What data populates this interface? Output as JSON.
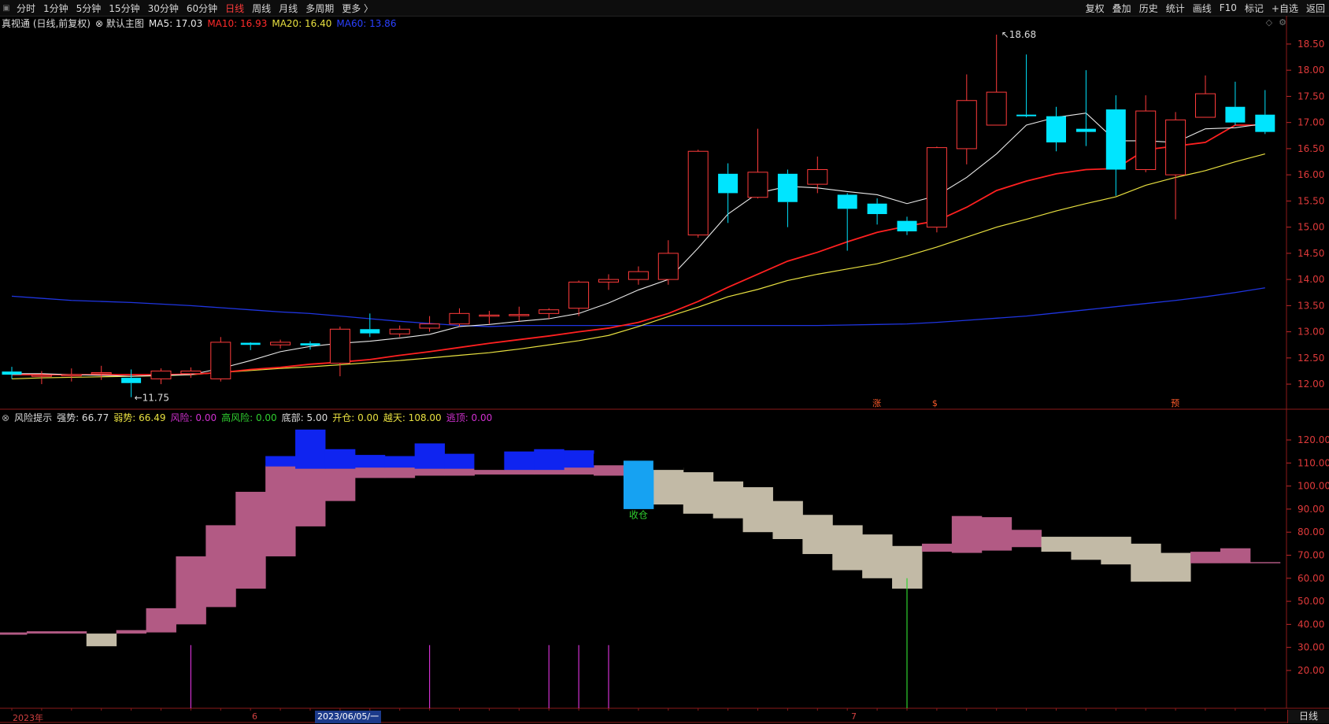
{
  "toolbar": {
    "left": [
      "分时",
      "1分钟",
      "5分钟",
      "15分钟",
      "30分钟",
      "60分钟",
      "日线",
      "周线",
      "月线",
      "多周期",
      "更多 〉"
    ],
    "active": "日线",
    "right": [
      "复权",
      "叠加",
      "历史",
      "统计",
      "画线",
      "F10",
      "标记",
      "+自选",
      "返回"
    ]
  },
  "main_legend": {
    "title": "真视通 (日线,前复权)",
    "template": "默认主图",
    "ma5_label": "MA5: 17.03",
    "ma10_label": "MA10: 16.93",
    "ma20_label": "MA20: 16.40",
    "ma60_label": "MA60: 13.86"
  },
  "sub_legend": {
    "title": "风险提示",
    "strong": "强势: 66.77",
    "weak": "弱势: 66.49",
    "risk": "风险: 0.00",
    "high_risk": "高风险: 0.00",
    "bottom": "底部: 5.00",
    "open": "开仓: 0.00",
    "sky": "越天: 108.00",
    "top_escape": "逃顶: 0.00"
  },
  "annotations": {
    "high": "18.68",
    "low": "11.75",
    "close_signal": "收仓",
    "markers": [
      "涨",
      "$",
      "预"
    ]
  },
  "bottom_axis": {
    "labels": [
      "2023年",
      "6",
      "7"
    ],
    "current_date": "2023/06/05/一",
    "period": "日线"
  },
  "colors": {
    "up": "#ff3b3b",
    "down": "#00e5ff",
    "ma5": "#e8e8e8",
    "ma10": "#ff2020",
    "ma20": "#e8e040",
    "ma60": "#1f35e0",
    "pink": "#b25a84",
    "beige": "#c2baa6",
    "blue": "#0f24f0",
    "light_blue": "#16a2f2"
  },
  "chart_data": {
    "type": "candlestick",
    "y_ticks_main": [
      "12.00",
      "12.50",
      "13.00",
      "13.50",
      "14.00",
      "14.50",
      "15.00",
      "15.50",
      "16.00",
      "16.50",
      "17.00",
      "17.50",
      "18.00",
      "18.50"
    ],
    "y_ticks_sub": [
      "20.00",
      "30.00",
      "40.00",
      "50.00",
      "60.00",
      "70.00",
      "80.00",
      "90.00",
      "100.00",
      "110.00",
      "120.00"
    ],
    "ylim_main": [
      11.52,
      18.77
    ],
    "ylim_sub": [
      3.6,
      126.5
    ],
    "candles": [
      [
        12.24,
        12.18,
        12.33,
        12.1
      ],
      [
        12.15,
        12.17,
        12.25,
        12.0
      ],
      [
        12.16,
        12.18,
        12.3,
        12.05
      ],
      [
        12.2,
        12.22,
        12.35,
        12.08
      ],
      [
        12.12,
        12.02,
        12.28,
        11.75
      ],
      [
        12.1,
        12.25,
        12.3,
        12.0
      ],
      [
        12.2,
        12.25,
        12.32,
        12.12
      ],
      [
        12.1,
        12.8,
        12.9,
        12.05
      ],
      [
        12.79,
        12.75,
        12.8,
        12.65
      ],
      [
        12.75,
        12.8,
        12.85,
        12.68
      ],
      [
        12.78,
        12.74,
        12.82,
        12.66
      ],
      [
        12.4,
        13.05,
        13.1,
        12.15
      ],
      [
        13.05,
        12.97,
        13.35,
        12.9
      ],
      [
        12.96,
        13.05,
        13.12,
        12.9
      ],
      [
        13.07,
        13.15,
        13.3,
        13.0
      ],
      [
        13.15,
        13.35,
        13.45,
        13.1
      ],
      [
        13.3,
        13.32,
        13.4,
        13.15
      ],
      [
        13.31,
        13.33,
        13.48,
        13.2
      ],
      [
        13.35,
        13.42,
        13.45,
        13.25
      ],
      [
        13.45,
        13.95,
        13.98,
        13.3
      ],
      [
        13.95,
        14.0,
        14.1,
        13.8
      ],
      [
        14.0,
        14.15,
        14.25,
        13.9
      ],
      [
        14.0,
        14.5,
        14.75,
        13.9
      ],
      [
        14.85,
        16.45,
        16.48,
        14.8
      ],
      [
        16.02,
        15.65,
        16.22,
        15.08
      ],
      [
        15.57,
        16.05,
        16.88,
        15.55
      ],
      [
        16.02,
        15.48,
        16.1,
        15.0
      ],
      [
        15.82,
        16.1,
        16.35,
        15.65
      ],
      [
        15.62,
        15.35,
        15.65,
        14.55
      ],
      [
        15.45,
        15.25,
        15.55,
        15.05
      ],
      [
        15.12,
        14.92,
        15.2,
        14.85
      ],
      [
        15.0,
        16.52,
        16.54,
        14.9
      ],
      [
        16.5,
        17.42,
        17.92,
        16.2
      ],
      [
        16.95,
        17.58,
        18.68,
        16.95
      ],
      [
        17.15,
        17.12,
        18.3,
        17.1
      ],
      [
        17.12,
        16.62,
        17.3,
        16.45
      ],
      [
        16.88,
        16.82,
        18.0,
        16.55
      ],
      [
        17.25,
        16.1,
        17.52,
        15.6
      ],
      [
        16.1,
        17.22,
        17.52,
        16.05
      ],
      [
        16.0,
        17.05,
        17.2,
        15.15
      ],
      [
        17.1,
        17.55,
        17.9,
        17.1
      ],
      [
        17.3,
        17.0,
        17.78,
        16.95
      ],
      [
        17.15,
        16.82,
        17.62,
        16.78
      ]
    ],
    "ma5": [
      12.2,
      12.2,
      12.18,
      12.17,
      12.15,
      12.17,
      12.18,
      12.3,
      12.45,
      12.62,
      12.72,
      12.78,
      12.82,
      12.88,
      12.95,
      13.1,
      13.14,
      13.2,
      13.25,
      13.35,
      13.55,
      13.8,
      14.0,
      14.6,
      15.25,
      15.65,
      15.78,
      15.75,
      15.68,
      15.62,
      15.45,
      15.6,
      15.95,
      16.4,
      16.95,
      17.1,
      17.18,
      16.65,
      16.65,
      16.62,
      16.88,
      16.9,
      16.98
    ],
    "ma10": [
      12.18,
      12.18,
      12.18,
      12.18,
      12.18,
      12.18,
      12.19,
      12.22,
      12.28,
      12.32,
      12.38,
      12.42,
      12.47,
      12.55,
      12.62,
      12.7,
      12.78,
      12.85,
      12.92,
      13.0,
      13.07,
      13.18,
      13.35,
      13.58,
      13.85,
      14.1,
      14.35,
      14.52,
      14.72,
      14.9,
      15.02,
      15.12,
      15.38,
      15.7,
      15.88,
      16.02,
      16.1,
      16.12,
      16.48,
      16.55,
      16.62,
      16.95,
      16.95
    ],
    "ma20": [
      12.1,
      12.12,
      12.13,
      12.14,
      12.15,
      12.16,
      12.18,
      12.22,
      12.26,
      12.3,
      12.33,
      12.37,
      12.41,
      12.45,
      12.5,
      12.55,
      12.6,
      12.67,
      12.75,
      12.83,
      12.93,
      13.1,
      13.29,
      13.47,
      13.67,
      13.81,
      13.98,
      14.1,
      14.2,
      14.3,
      14.45,
      14.62,
      14.81,
      15.0,
      15.15,
      15.31,
      15.45,
      15.58,
      15.8,
      15.95,
      16.08,
      16.25,
      16.4
    ],
    "ma60": [
      13.68,
      13.64,
      13.6,
      13.58,
      13.56,
      13.53,
      13.5,
      13.46,
      13.42,
      13.38,
      13.35,
      13.3,
      13.25,
      13.2,
      13.16,
      13.12,
      13.1,
      13.12,
      13.12,
      13.12,
      13.12,
      13.12,
      13.12,
      13.12,
      13.12,
      13.12,
      13.12,
      13.12,
      13.13,
      13.14,
      13.15,
      13.18,
      13.22,
      13.26,
      13.3,
      13.36,
      13.42,
      13.48,
      13.54,
      13.6,
      13.67,
      13.75,
      13.84
    ],
    "risk_bands": [
      [
        35.5,
        36.5,
        "pink"
      ],
      [
        36,
        37,
        "pink"
      ],
      [
        36,
        37,
        "pink"
      ],
      [
        30.5,
        36,
        "beige"
      ],
      [
        36,
        37.5,
        "pink"
      ],
      [
        36.5,
        47,
        "pink"
      ],
      [
        40,
        69.5,
        "pink"
      ],
      [
        47.5,
        83,
        "pink"
      ],
      [
        55.5,
        97.5,
        "pink"
      ],
      [
        69.5,
        109,
        "pink"
      ],
      [
        82.5,
        109,
        "pink"
      ],
      [
        93.5,
        109,
        "pink"
      ],
      [
        103.5,
        109,
        "pink"
      ],
      [
        103.5,
        109,
        "pink"
      ],
      [
        104.5,
        111,
        "pink"
      ],
      [
        104.5,
        112.5,
        "pink"
      ],
      [
        105,
        112,
        "pink"
      ],
      [
        105,
        111,
        "pink"
      ],
      [
        105,
        111.5,
        "pink"
      ],
      [
        105,
        111,
        "pink"
      ],
      [
        104.5,
        110,
        "pink"
      ],
      [
        103,
        108.5,
        "pink"
      ],
      [
        92,
        108,
        "beige"
      ],
      [
        88,
        106,
        "beige"
      ],
      [
        86,
        102,
        "beige"
      ],
      [
        80,
        99.5,
        "beige"
      ],
      [
        77,
        93.5,
        "beige"
      ],
      [
        70.5,
        87.5,
        "beige"
      ],
      [
        63.5,
        83,
        "beige"
      ],
      [
        60,
        79,
        "beige"
      ],
      [
        55.5,
        74,
        "beige"
      ],
      [
        71.5,
        75,
        "pink"
      ],
      [
        71,
        87,
        "pink"
      ],
      [
        72,
        86.5,
        "pink"
      ],
      [
        73.5,
        81,
        "pink"
      ],
      [
        71.5,
        78,
        "beige"
      ],
      [
        68,
        78,
        "beige"
      ],
      [
        66,
        78,
        "beige"
      ],
      [
        58.5,
        75,
        "beige"
      ],
      [
        58.5,
        71,
        "beige"
      ],
      [
        66.5,
        71.5,
        "pink"
      ],
      [
        66.5,
        73,
        "pink"
      ],
      [
        66.5,
        67,
        "pink"
      ]
    ],
    "blue_bars": [
      [
        null,
        null
      ],
      [
        null,
        null
      ],
      [
        null,
        null
      ],
      [
        null,
        null
      ],
      [
        null,
        null
      ],
      [
        null,
        null
      ],
      [
        null,
        null
      ],
      [
        null,
        null
      ],
      [
        null,
        null
      ],
      [
        108.5,
        113,
        "blue"
      ],
      [
        107.5,
        124.5,
        "blue"
      ],
      [
        107.5,
        116,
        "blue"
      ],
      [
        108,
        113.5,
        "blue"
      ],
      [
        108,
        113,
        "blue"
      ],
      [
        107.5,
        118.5,
        "blue"
      ],
      [
        107.5,
        114,
        "blue"
      ],
      [
        107,
        115,
        "white"
      ],
      [
        107,
        115,
        "blue"
      ],
      [
        107,
        116,
        "blue"
      ],
      [
        108,
        115.5,
        "blue"
      ],
      [
        109,
        114,
        "white"
      ],
      [
        90,
        111,
        "light_blue"
      ],
      [
        107,
        112.5,
        "white"
      ],
      [
        108,
        109.5,
        "white"
      ]
    ],
    "risk_spikes": [
      {
        "i": 6,
        "v": 31
      },
      {
        "i": 14,
        "v": 31
      },
      {
        "i": 18,
        "v": 31
      },
      {
        "i": 19,
        "v": 31
      },
      {
        "i": 20,
        "v": 31
      }
    ],
    "green_spikes": [
      {
        "i": 30,
        "v": 60
      }
    ]
  }
}
